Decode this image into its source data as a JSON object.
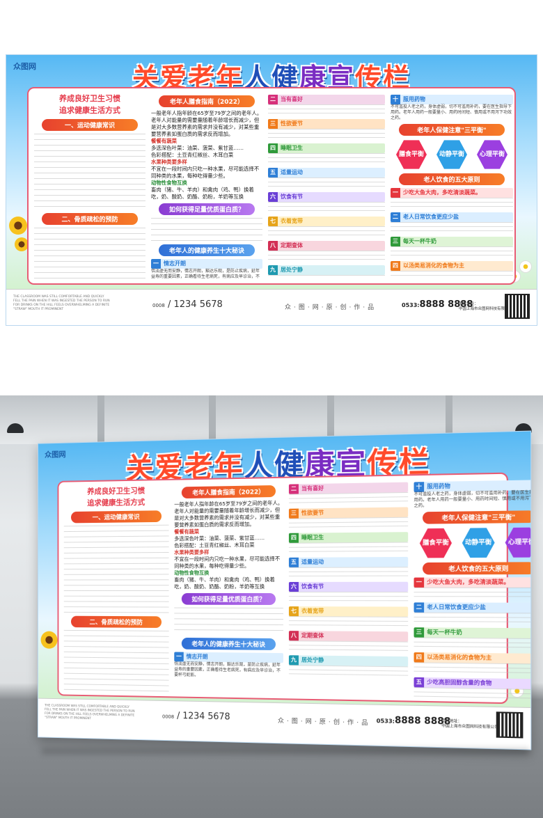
{
  "watermark": "众图网",
  "poster": {
    "logo": "众图网",
    "title_chars": [
      "关",
      "爱",
      "老",
      "年",
      "人",
      "健",
      "康",
      "宣",
      "传",
      "栏"
    ],
    "col1": {
      "heading_line1": "养成良好卫生习惯",
      "heading_line2": "追求健康生活方式",
      "section1": "一、运动健康常识",
      "section2": "二、骨质疏松的预防"
    },
    "col2": {
      "guide_title": "老年人膳食指南（2022）",
      "intro": "一般老年人指年龄在65岁至79岁之间的老年人。老年人对能量的需要量随着年龄增长而减少，但是对大多数营养素的需求并没有减少，对某些重要营养素如蛋白质的需求反而增加。",
      "food_head": "餐餐有蔬菜",
      "food_line1": "多选深色叶菜：油菜、菠菜、紫甘蓝……",
      "food_line2": "色彩搭配：土豆青红椒丝、木耳白菜",
      "fruit_head": "水果种类要多样",
      "fruit_text": "不宜在一段时间内只吃一种水果，尽可能选择不同种类的水果，每种吃得量少些。",
      "protein_head": "动物性食物互换",
      "protein_text": "畜肉（猪、牛、羊肉）和禽肉（鸡、鸭）换着吃，奶、酸奶、奶酪、奶粉，羊奶等互换",
      "how_pill": "如何获得足量优质蛋白质？",
      "ten_pill": "老年人的健康养生十大秘诀",
      "tip1": "情志开朗",
      "tip1_text": "恬淡虚无而安静，情志开朗，豁达乐观，是防止疾病，延年益寿的重要因素，正确看待生老病死，有病应及早诊治，不要杯弓蛇影。"
    },
    "col3": {
      "items": [
        {
          "num": "二",
          "title": "当有喜好",
          "bg": "#f3d6ea",
          "n": "#d6307a"
        },
        {
          "num": "三",
          "title": "性欲要节",
          "bg": "#ffe3c4",
          "n": "#f07a1a"
        },
        {
          "num": "四",
          "title": "睡眠卫生",
          "bg": "#d9f2d0",
          "n": "#2f9a3a"
        },
        {
          "num": "五",
          "title": "适量运动",
          "bg": "#dcefff",
          "n": "#2f7fd6"
        },
        {
          "num": "六",
          "title": "饮食有节",
          "bg": "#e6dbff",
          "n": "#6a3fd6"
        },
        {
          "num": "七",
          "title": "衣着宽带",
          "bg": "#fff0c8",
          "n": "#e6a41a"
        },
        {
          "num": "八",
          "title": "定期查体",
          "bg": "#f8d6de",
          "n": "#d32f55"
        },
        {
          "num": "九",
          "title": "居处宁静",
          "bg": "#d7f1f5",
          "n": "#1f9ab0"
        }
      ]
    },
    "col4": {
      "item10_num": "十",
      "item10_title": "服用药物",
      "item10_text": "不可滥投人老之药，身体虚弱，切不可滥用补药，要在医生指导下用药。老年人用药一般要量小、用药时间短、慎用或不用泻下功效之药。",
      "balance_pill": "老年人保健注意\"三平衡\"",
      "hexes": [
        {
          "label": "膳食平衡"
        },
        {
          "label": "动静平衡"
        },
        {
          "label": "心理平衡"
        }
      ],
      "diet_pill": "老人饮食的五大原则",
      "rules": [
        {
          "num": "一",
          "title": "少吃大鱼大肉，多吃清淡蔬菜。",
          "bg": "#ffe1e1",
          "n": "#e5363d"
        },
        {
          "num": "二",
          "title": "老人日常饮食更应少盐",
          "bg": "#dbeeff",
          "n": "#2f7fd6"
        },
        {
          "num": "三",
          "title": "每天一杯牛奶",
          "bg": "#dff4d6",
          "n": "#2f9a3a"
        },
        {
          "num": "四",
          "title": "以汤类易消化的食物为主",
          "bg": "#ffead0",
          "n": "#f07a1a"
        },
        {
          "num": "五",
          "title": "少吃高胆固醇含量的食物",
          "bg": "#ead9ff",
          "n": "#7a3fd6"
        }
      ]
    },
    "footer": {
      "english": "THE CLASSROOM WAS STILL COMFORTABLE AND QUICKLY FELL THE PAIN WHEN IT WAS INGESTED THE PERSON TO RUN FOR DRINKS ON THE HILL FEELS OVERWHELMING A DEFINITE \"STRAW\" MOUTH IT PROMINENT",
      "phone1_prefix": "0008",
      "phone1": "/ 1234 5678",
      "slogan": "众·图·网·原·创·作·品",
      "phone2_prefix": "0533:",
      "phone2": "8888 8888",
      "address_label": "项目地址：",
      "address": "中国上海市众图网科技有限公司"
    }
  }
}
